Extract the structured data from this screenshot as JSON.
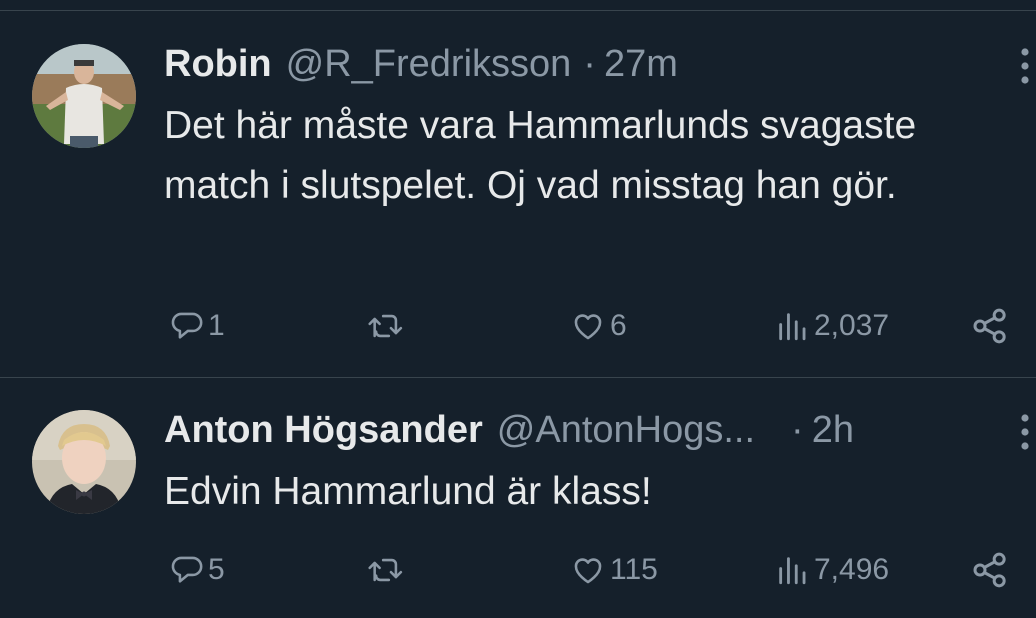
{
  "tweets": [
    {
      "name": "Robin",
      "handle": "@R_Fredriksson",
      "separator": "·",
      "time": "27m",
      "text": "Det här måste vara Hammarlunds svagaste match i slutspelet. Oj vad misstag han gör.",
      "replies": "1",
      "likes": "6",
      "views": "2,037"
    },
    {
      "name": "Anton Högsander",
      "handle": "@AntonHogs...",
      "separator": "·",
      "time": "2h",
      "text": "Edvin Hammarlund är klass!",
      "replies": "5",
      "likes": "115",
      "views": "7,496"
    }
  ],
  "icons": {
    "reply": "reply-icon",
    "retweet": "retweet-icon",
    "like": "heart-icon",
    "views": "views-icon",
    "share": "share-icon",
    "more": "more-options-icon"
  },
  "colors": {
    "background": "#15202b",
    "text_primary": "#e7e9ea",
    "text_secondary": "#8b98a5",
    "divider": "#38444d"
  }
}
